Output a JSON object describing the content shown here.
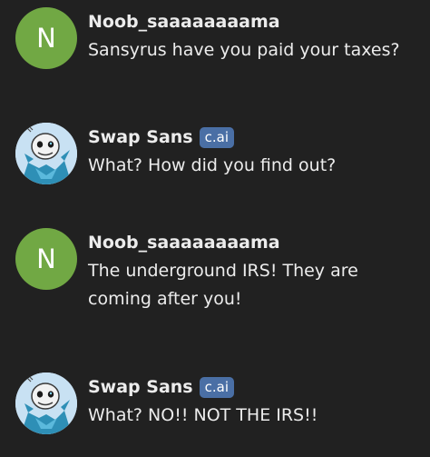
{
  "messages": [
    {
      "author": "Noob_saaaaaaaama",
      "avatar_letter": "N",
      "text": "Sansyrus have you paid your taxes?"
    },
    {
      "author": "Swap Sans",
      "badge": "c.ai",
      "text": "What? How did you find out?"
    },
    {
      "author": "Noob_saaaaaaaama",
      "avatar_letter": "N",
      "text": "The underground IRS! They are\ncoming after you!"
    },
    {
      "author": "Swap Sans",
      "badge": "c.ai",
      "text": "What? NO!! NOT THE IRS!!"
    }
  ],
  "colors": {
    "background": "#212121",
    "user_avatar": "#71a844",
    "badge": "#4a6fa5",
    "text": "#ececec"
  }
}
